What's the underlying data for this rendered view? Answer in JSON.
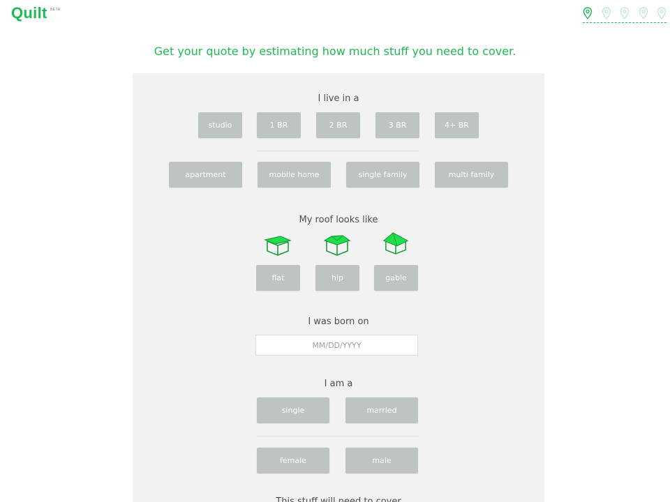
{
  "header": {
    "logo": "Quilt",
    "logo_badge": "BETA",
    "progress_steps": [
      "step-1",
      "step-2",
      "step-3",
      "step-4",
      "step-5"
    ],
    "accent": "#1db954"
  },
  "headline": "Get your quote by estimating how much stuff you need to cover.",
  "live_in": {
    "label": "I live in a",
    "sizes": [
      "studio",
      "1 BR",
      "2 BR",
      "3 BR",
      "4+ BR"
    ],
    "types": [
      "apartment",
      "mobile home",
      "single family",
      "multi family"
    ]
  },
  "roof": {
    "label": "My roof looks like",
    "options": [
      "flat",
      "hip",
      "gable"
    ],
    "icons": [
      "flat-roof-icon",
      "hip-roof-icon",
      "gable-roof-icon"
    ]
  },
  "birth": {
    "label": "I was born on",
    "placeholder": "MM/DD/YYYY",
    "value": ""
  },
  "identity": {
    "label": "I am a",
    "marital": [
      "single",
      "married"
    ],
    "gender": [
      "female",
      "male"
    ]
  },
  "next_section_label": "This stuff will need to cover"
}
